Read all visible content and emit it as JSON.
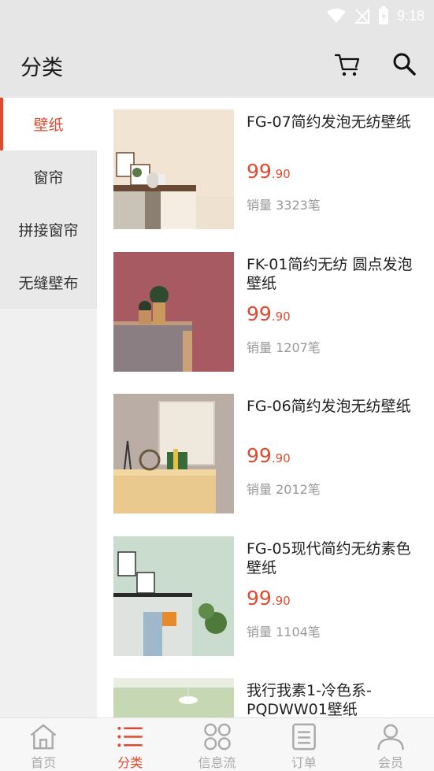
{
  "status_bar": {
    "time": "9:18",
    "icons": [
      "wifi-icon",
      "no-signal-icon",
      "battery-charging-icon"
    ]
  },
  "header": {
    "title": "分类",
    "icons": [
      "cart-icon",
      "search-icon"
    ]
  },
  "sidebar": {
    "items": [
      {
        "label": "壁纸",
        "active": true
      },
      {
        "label": "窗帘",
        "active": false
      },
      {
        "label": "拼接窗帘",
        "active": false
      },
      {
        "label": "无缝壁布",
        "active": false
      }
    ]
  },
  "products": [
    {
      "name": "FG-07简约发泡无纺壁纸",
      "price_int": "99",
      "price_dec": ".90",
      "sales": "销量 3323笔"
    },
    {
      "name": "FK-01简约无纺 圆点发泡壁纸",
      "price_int": "99",
      "price_dec": ".90",
      "sales": "销量 1207笔"
    },
    {
      "name": "FG-06简约发泡无纺壁纸",
      "price_int": "99",
      "price_dec": ".90",
      "sales": "销量 2012笔"
    },
    {
      "name": "FG-05现代简约无纺素色壁纸",
      "price_int": "99",
      "price_dec": ".90",
      "sales": "销量 1104笔"
    },
    {
      "name": "我行我素1-冷色系-PQDWW01壁纸",
      "price_int": "",
      "price_dec": "",
      "sales": ""
    }
  ],
  "tabbar": {
    "tabs": [
      {
        "label": "首页",
        "icon": "home-icon",
        "active": false
      },
      {
        "label": "分类",
        "icon": "list-icon",
        "active": true
      },
      {
        "label": "信息流",
        "icon": "grid-icon",
        "active": false
      },
      {
        "label": "订单",
        "icon": "order-icon",
        "active": false
      },
      {
        "label": "会员",
        "icon": "user-icon",
        "active": false
      }
    ]
  },
  "colors": {
    "accent": "#e04a2f",
    "header_bg": "#e6e6e6"
  }
}
